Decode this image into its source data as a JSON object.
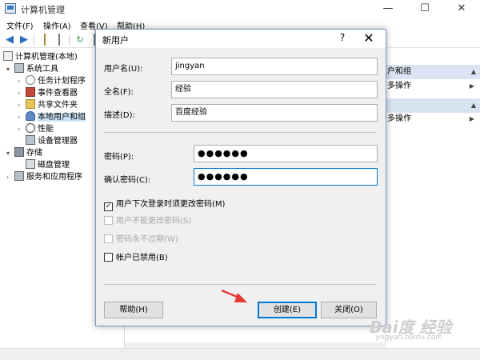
{
  "window": {
    "title": "计算机管理",
    "controls": [
      "—",
      "☐",
      "✕"
    ]
  },
  "menu": [
    "文件(F)",
    "操作(A)",
    "查看(V)",
    "帮助(H)"
  ],
  "tree": [
    {
      "label": "计算机管理(本地)",
      "level": 0
    },
    {
      "label": "系统工具",
      "level": 1
    },
    {
      "label": "任务计划程序",
      "level": 2
    },
    {
      "label": "事件查看器",
      "level": 2
    },
    {
      "label": "共享文件夹",
      "level": 2
    },
    {
      "label": "本地用户和组",
      "level": 2
    },
    {
      "label": "性能",
      "level": 2
    },
    {
      "label": "设备管理器",
      "level": 2
    },
    {
      "label": "存储",
      "level": 1
    },
    {
      "label": "磁盘管理",
      "level": 2
    },
    {
      "label": "服务和应用程序",
      "level": 1
    }
  ],
  "actions": {
    "header1": "户和组",
    "item1": "多操作",
    "item2": "多操作"
  },
  "dialog": {
    "title": "新用户",
    "help_glyph": "?",
    "close_glyph": "✕",
    "username_label": "用户名(U):",
    "username_value": "jingyan",
    "fullname_label": "全名(F):",
    "fullname_value": "经验",
    "description_label": "描述(D):",
    "description_value": "百度经验",
    "password_label": "密码(P):",
    "password_value": "●●●●●●",
    "confirm_label": "确认密码(C):",
    "confirm_value": "●●●●●●",
    "checkboxes": [
      {
        "label": "用户下次登录时须更改密码(M)",
        "checked": true,
        "disabled": false
      },
      {
        "label": "用户不能更改密码(S)",
        "checked": false,
        "disabled": true
      },
      {
        "label": "密码永不过期(W)",
        "checked": false,
        "disabled": true
      },
      {
        "label": "帐户已禁用(B)",
        "checked": false,
        "disabled": false
      }
    ],
    "help_button": "帮助(H)",
    "create_button": "创建(E)",
    "close_button": "关闭(O)"
  },
  "watermark": {
    "main": "Bai度 经验",
    "sub": "jingyan.baidu.com"
  },
  "colors": {
    "accent": "#0078d7",
    "arrow": "#e53935"
  }
}
